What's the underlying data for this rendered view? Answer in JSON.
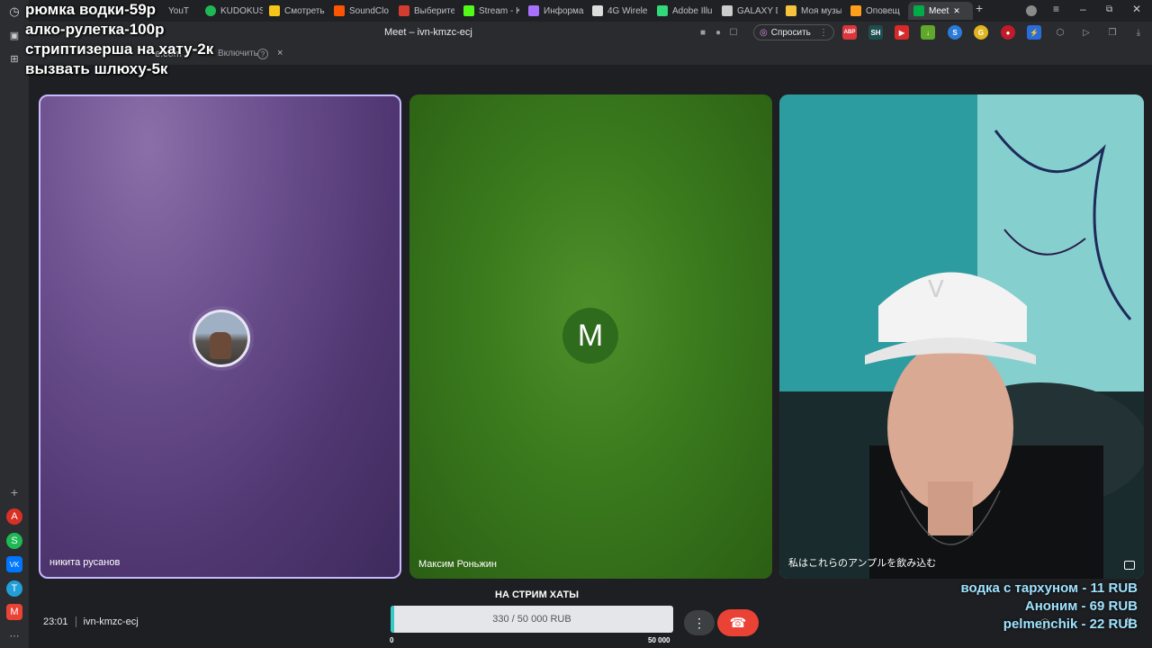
{
  "browser": {
    "tabs": [
      {
        "label": "YouT",
        "color": "#ff0000"
      },
      {
        "label": "KUDOKUS",
        "color": "#1db954"
      },
      {
        "label": "Смотреть",
        "color": "#f5c518"
      },
      {
        "label": "SoundClo",
        "color": "#ff5500"
      },
      {
        "label": "Выберите",
        "color": "#d43c2f"
      },
      {
        "label": "Stream - K",
        "color": "#53fc18"
      },
      {
        "label": "Информа",
        "color": "#a970ff"
      },
      {
        "label": "4G Wirele",
        "color": "#dddddd"
      },
      {
        "label": "Adobe Illu",
        "color": "#32d97a"
      },
      {
        "label": "GALAXY D",
        "color": "#cccccc"
      },
      {
        "label": "Моя музы",
        "color": "#f6c43c"
      },
      {
        "label": "Оповещ",
        "color": "#ff9f1c"
      },
      {
        "label": "Meet",
        "color": "#00ac47"
      }
    ],
    "page_title": "Meet – ivn-kmzc-ecj",
    "ask_label": "Спросить",
    "extensions": [
      {
        "label": "ABP",
        "color": "#d9363e"
      },
      {
        "label": "SH",
        "color": "#1e4d4d"
      },
      {
        "label": "▶",
        "color": "#d92a2a"
      },
      {
        "label": "↓",
        "color": "#5fa82a"
      },
      {
        "label": "S",
        "color": "#2a7bd9"
      },
      {
        "label": "G",
        "color": "#e0b520"
      },
      {
        "label": "●",
        "color": "#c01c28"
      },
      {
        "label": "⚡",
        "color": "#2a6dd9"
      }
    ],
    "notification": {
      "domain": "e.com",
      "action": "Включить",
      "help": "?",
      "close": "×"
    }
  },
  "sidebar": {
    "apps": [
      "+",
      "A",
      "S",
      "VK",
      "T",
      "M",
      "⋯"
    ]
  },
  "overlay": {
    "price_list": [
      "рюмка водки-59р",
      "алко-рулетка-100р",
      "стриптизерша на хату-2к",
      "вызвать шлюху-5к"
    ],
    "donations": [
      "водка с тархуном - 11 RUB",
      "Аноним - 69 RUB",
      "pelmenchik - 22 RUB"
    ],
    "goal": {
      "title": "НА СТРИМ ХАТЫ",
      "text": "330 / 50 000 RUB",
      "current": 330,
      "target": 50000,
      "min_label": "0",
      "max_label": "50 000"
    }
  },
  "meet": {
    "participants": [
      {
        "name": "никита русанов",
        "type": "avatar-photo"
      },
      {
        "name": "Максим Роньжин",
        "type": "letter",
        "letter": "M"
      },
      {
        "name": "私はこれらのアンプルを飲み込む",
        "type": "video"
      }
    ],
    "time": "23:01",
    "meeting_code": "ivn-kmzc-ecj",
    "more_icon": "⋮",
    "hangup_icon": "☎"
  }
}
